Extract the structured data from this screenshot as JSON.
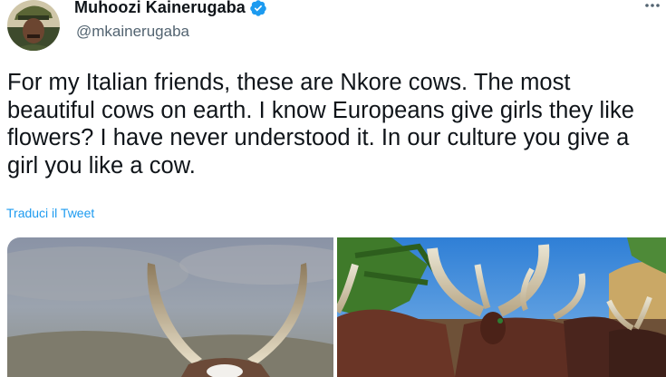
{
  "author": {
    "name": "Muhoozi Kainerugaba",
    "handle": "@mkainerugaba"
  },
  "tweet": {
    "text": "For my Italian friends, these are Nkore cows. The most beautiful cows on earth. I know Europeans give girls they like flowers? I have never understood it. In our culture you give a girl you like a cow.",
    "translate_label": "Traduci il Tweet"
  },
  "icons": {
    "verified": "verified-badge-icon",
    "more": "more-options-icon"
  },
  "colors": {
    "accent": "#1d9bf0",
    "secondary_text": "#536471"
  }
}
